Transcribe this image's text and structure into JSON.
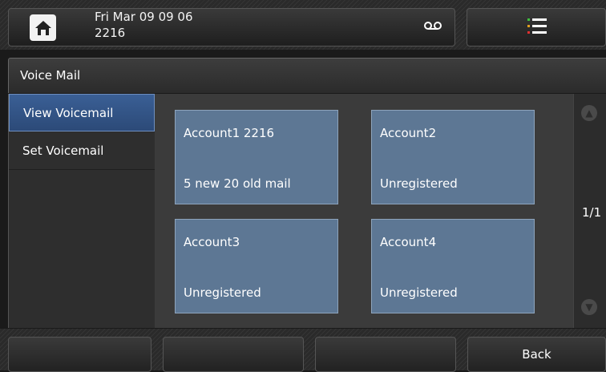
{
  "status_bar": {
    "datetime": "Fri Mar 09 09 06",
    "extension": "2216",
    "icons": [
      "home-icon",
      "voicemail-icon",
      "menu-list-icon"
    ],
    "menu_icon_colors": [
      "#40c040",
      "#e0a020",
      "#e03030"
    ]
  },
  "title": "Voice Mail",
  "menu": {
    "items": [
      {
        "label": "View Voicemail",
        "active": true
      },
      {
        "label": "Set Voicemail",
        "active": false
      }
    ]
  },
  "accounts": [
    {
      "name": "Account1 2216",
      "status": "5 new 20 old mail"
    },
    {
      "name": "Account2",
      "status": "Unregistered"
    },
    {
      "name": "Account3",
      "status": "Unregistered"
    },
    {
      "name": "Account4",
      "status": "Unregistered"
    }
  ],
  "pager": {
    "indicator": "1/1"
  },
  "softkeys": [
    {
      "label": ""
    },
    {
      "label": ""
    },
    {
      "label": ""
    },
    {
      "label": "Back"
    }
  ],
  "colors": {
    "accent": "#3a5f95",
    "tile": "#5d7794",
    "background": "#1a1a1a"
  }
}
